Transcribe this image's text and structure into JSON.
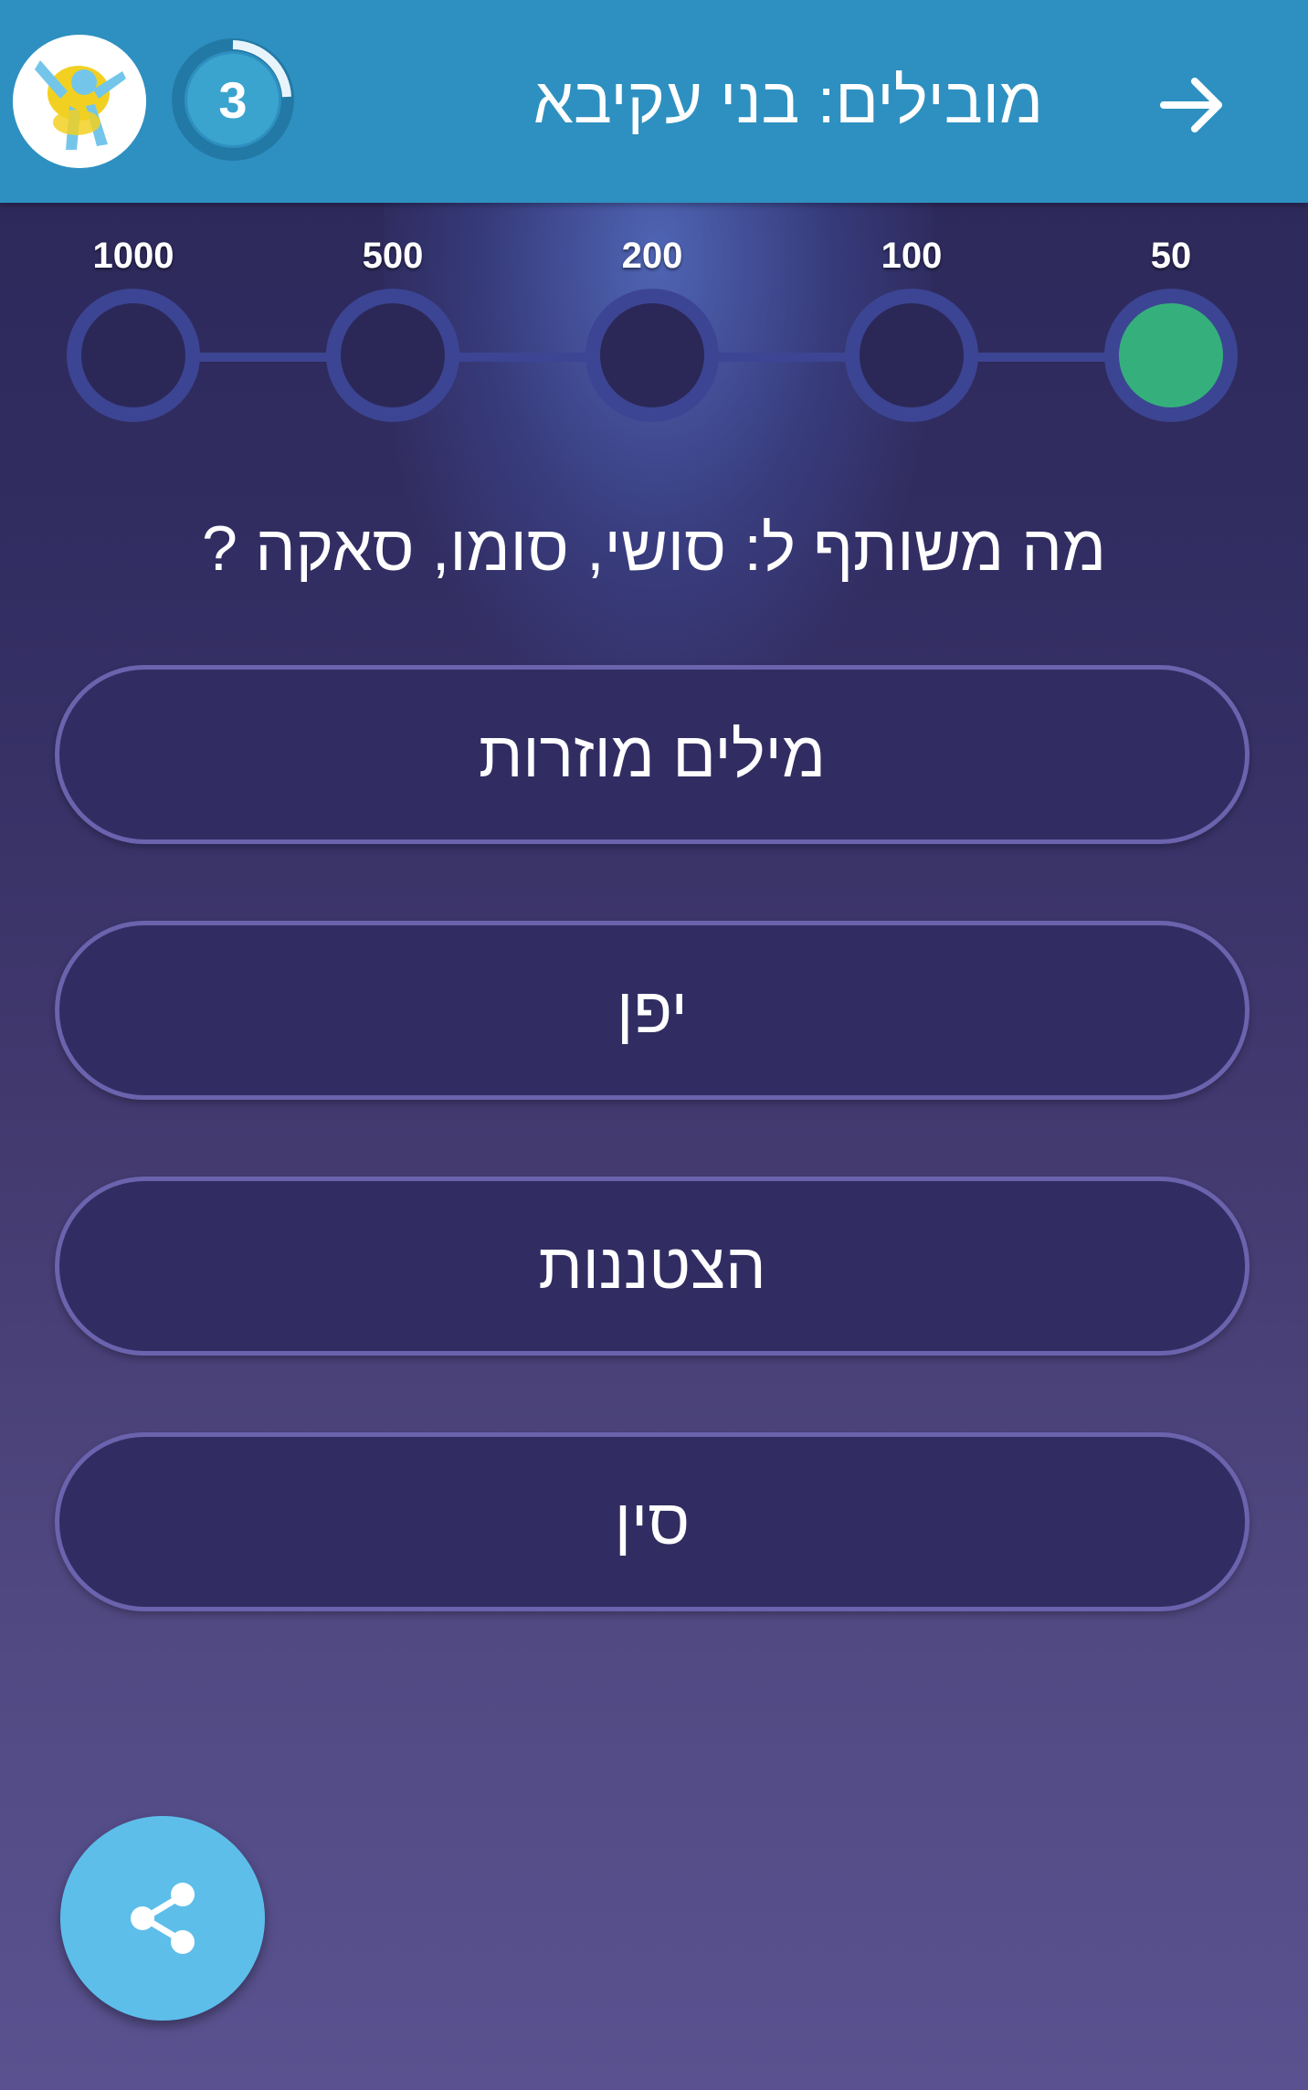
{
  "header": {
    "title": "מובילים: בני עקיבא",
    "timer_value": "3",
    "back_icon": "arrow-right-icon",
    "avatar_icon": "avatar-figure-icon",
    "background_color": "#2e90c0"
  },
  "ladder": {
    "levels": [
      "1000",
      "500",
      "200",
      "100",
      "50"
    ],
    "current_level": "50",
    "active_color": "#35b07c"
  },
  "question": {
    "text": "מה משותף ל: סושי, סומו, סאקה ?"
  },
  "answers": [
    {
      "label": "מילים מוזרות"
    },
    {
      "label": "יפן"
    },
    {
      "label": "הצטננות"
    },
    {
      "label": "סין"
    }
  ],
  "share": {
    "icon": "share-icon",
    "color": "#5dbeea"
  }
}
